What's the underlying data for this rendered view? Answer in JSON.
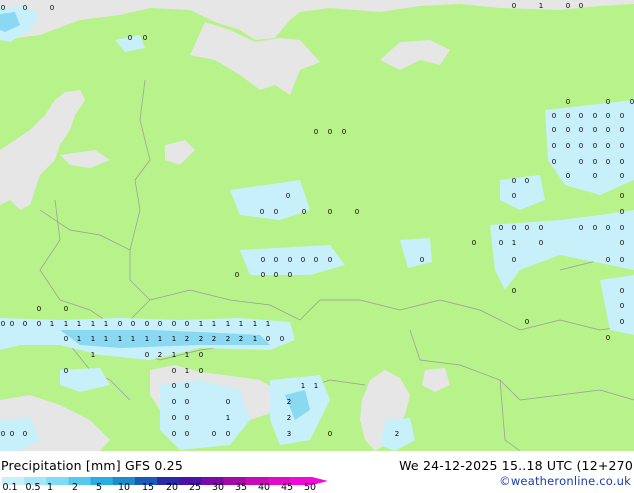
{
  "title": "Precipitation [mm]  GFS 0.25",
  "datetime": "We 24-12-2025 15..18 UTC (12+270",
  "credit": "©weatheronline.co.uk",
  "colors": {
    "land": "#b7f28a",
    "sea": "#e6e6e6",
    "border": "#9a9a9a",
    "precip_light": "#c8f0fb",
    "precip_mid": "#8ad8f2",
    "precip_heavy": "#3ab8e4"
  },
  "legend": {
    "labels": [
      "0.1",
      "0.5",
      "1",
      "2",
      "5",
      "10",
      "15",
      "20",
      "25",
      "30",
      "35",
      "40",
      "45",
      "50"
    ],
    "colors": [
      "#c8f0fb",
      "#a6e6f8",
      "#82dbf5",
      "#55c8ee",
      "#2aaee2",
      "#1b8ccc",
      "#1a5ab8",
      "#2a2aa8",
      "#4b11a8",
      "#7a0aa8",
      "#a50aa8",
      "#c80ab8",
      "#e00ac8",
      "#f00ad8"
    ]
  },
  "grid_values": [
    {
      "row": 10,
      "cols": [
        10,
        30,
        50,
        70,
        90,
        110,
        130,
        150,
        170,
        190,
        210,
        230,
        250,
        270
      ],
      "text": "0"
    },
    {
      "row": 22,
      "cols": [
        10,
        30,
        50,
        70,
        90,
        110,
        130,
        150,
        170,
        190,
        210,
        230,
        250,
        270
      ],
      "text": "1"
    },
    {
      "row": 38,
      "cols": [
        10,
        30,
        50,
        70,
        90,
        110,
        130,
        150,
        170,
        190,
        210,
        230,
        250,
        270
      ],
      "text": "2"
    }
  ]
}
